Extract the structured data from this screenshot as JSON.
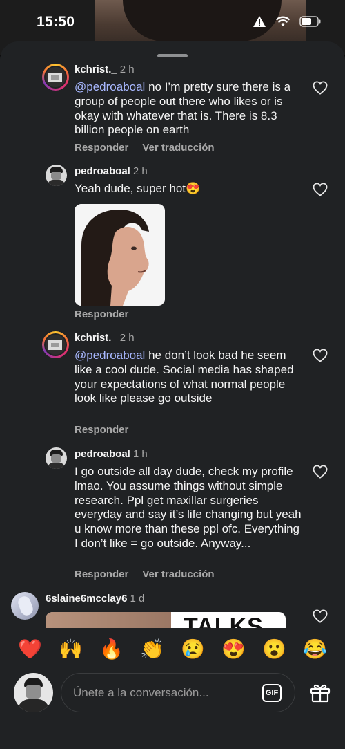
{
  "status": {
    "time": "15:50"
  },
  "comments": [
    {
      "user": "kchrist._",
      "time": "2 h",
      "mention": "@pedroaboal",
      "text": " no I’m pretty sure there is a group of people out there who likes or is okay with whatever that is. There is 8.3 billion people on earth",
      "reply": "Responder",
      "translate": "Ver traducción"
    },
    {
      "user": "pedroaboal",
      "time": "2 h",
      "text": "Yeah dude, super hot😍",
      "reply": "Responder"
    },
    {
      "user": "kchrist._",
      "time": "2 h",
      "mention": "@pedroaboal",
      "text": " he don’t look bad he seem like a cool dude. Social media has shaped your expectations of what normal people look like please go outside",
      "reply": "Responder"
    },
    {
      "user": "pedroaboal",
      "time": "1 h",
      "text": "I go outside all day dude, check my profile lmao. You assume things without simple research. Ppl get maxillar surgeries everyday and say it’s life changing but yeah u know more than these ppl ofc. Everything I don’t like = go outside. Anyway...",
      "reply": "Responder",
      "translate": "Ver traducción"
    },
    {
      "user": "6slaine6mcclay6",
      "time": "1 d",
      "image_text": "TALKS"
    }
  ],
  "reactions": [
    "❤️",
    "🙌",
    "🔥",
    "👏",
    "😢",
    "😍",
    "😮",
    "😂"
  ],
  "composer": {
    "placeholder": "Únete a la conversación...",
    "gif_label": "GIF"
  },
  "icons": [
    "warning-icon",
    "wifi-icon",
    "battery-icon",
    "heart-icon",
    "gif-icon",
    "gift-icon"
  ]
}
